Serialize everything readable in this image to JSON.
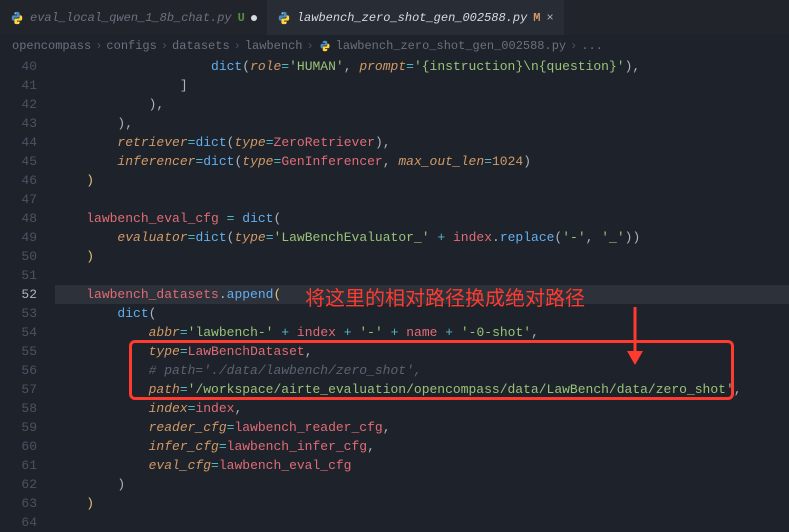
{
  "tabs": [
    {
      "label": "eval_local_qwen_1_8b_chat.py",
      "status": "U"
    },
    {
      "label": "lawbench_zero_shot_gen_002588.py",
      "status": "M"
    }
  ],
  "breadcrumbs": {
    "p0": "opencompass",
    "p1": "configs",
    "p2": "datasets",
    "p3": "lawbench",
    "p4": "lawbench_zero_shot_gen_002588.py",
    "more": "..."
  },
  "lines": {
    "n40": "40",
    "n41": "41",
    "n42": "42",
    "n43": "43",
    "n44": "44",
    "n45": "45",
    "n46": "46",
    "n47": "47",
    "n48": "48",
    "n49": "49",
    "n50": "50",
    "n51": "51",
    "n52": "52",
    "n53": "53",
    "n54": "54",
    "n55": "55",
    "n56": "56",
    "n57": "57",
    "n58": "58",
    "n59": "59",
    "n60": "60",
    "n61": "61",
    "n62": "62",
    "n63": "63",
    "n64": "64"
  },
  "code": {
    "l40_dict": "dict",
    "l40_role": "role",
    "l40_human": "'HUMAN'",
    "l40_prompt": "prompt",
    "l40_tmpl": "'{instruction}\\n{question}'",
    "l44_ret": "retriever",
    "l44_dict": "dict",
    "l44_type": "type",
    "l44_zr": "ZeroRetriever",
    "l45_inf": "inferencer",
    "l45_dict": "dict",
    "l45_type": "type",
    "l45_gi": "GenInferencer",
    "l45_mol": "max_out_len",
    "l45_1024": "1024",
    "l48_var": "lawbench_eval_cfg",
    "l48_dict": "dict",
    "l49_eval": "evaluator",
    "l49_dict": "dict",
    "l49_type": "type",
    "l49_str": "'LawBenchEvaluator_'",
    "l49_idx": "index",
    "l49_rep": "replace",
    "l49_a": "'-'",
    "l49_b": "'_'",
    "l52_var": "lawbench_datasets",
    "l52_app": "append",
    "l53_dict": "dict",
    "l54_abbr": "abbr",
    "l54_s1": "'lawbench-'",
    "l54_idx": "index",
    "l54_s2": "'-'",
    "l54_name": "name",
    "l54_s3": "'-0-shot'",
    "l55_type": "type",
    "l55_lbd": "LawBenchDataset",
    "l56_cmt": "# path='./data/lawbench/zero_shot',",
    "l57_path": "path",
    "l57_str": "'/workspace/airte_evaluation/opencompass/data/LawBench/data/zero_shot'",
    "l58_idx": "index",
    "l58_val": "index",
    "l59_k": "reader_cfg",
    "l59_v": "lawbench_reader_cfg",
    "l60_k": "infer_cfg",
    "l60_v": "lawbench_infer_cfg",
    "l61_k": "eval_cfg",
    "l61_v": "lawbench_eval_cfg"
  },
  "annotation": "将这里的相对路径换成绝对路径"
}
